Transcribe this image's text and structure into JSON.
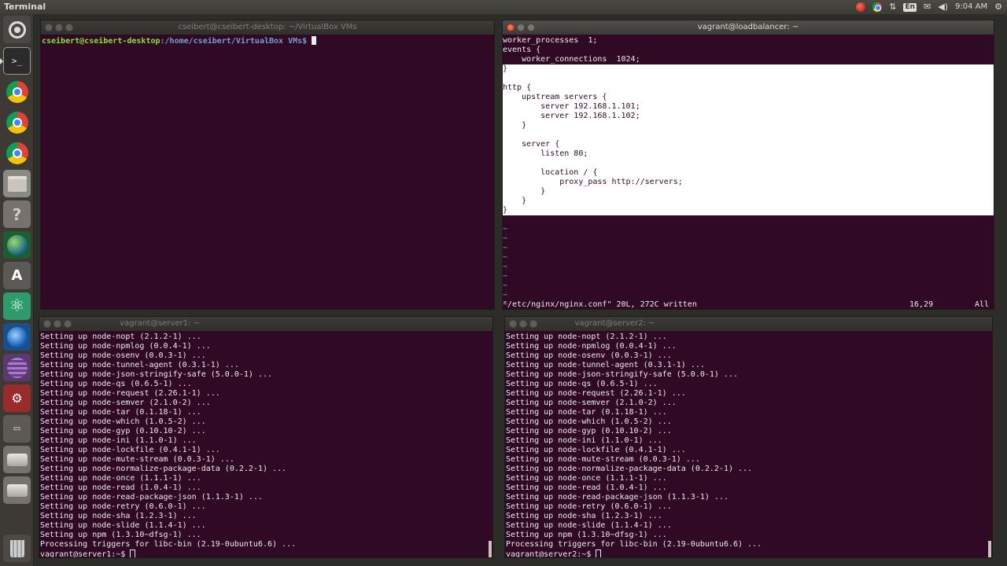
{
  "top_panel": {
    "app_title": "Terminal",
    "language": "En",
    "clock": "9:04 AM",
    "indicators": [
      "network-icon",
      "volume-icon",
      "settings-icon"
    ]
  },
  "launcher": {
    "items": [
      "dash",
      "terminal",
      "chrome",
      "chrome",
      "chrome",
      "files",
      "help",
      "globe",
      "a-app",
      "atom",
      "blue-globe",
      "purple",
      "settings",
      "small-terminal",
      "drive",
      "drive",
      "trash"
    ],
    "terminal_glyph": ">_",
    "help_glyph": "?",
    "a_glyph": "A",
    "atom_glyph": "⚛",
    "settings_glyph": "⚙",
    "small_term_glyph": "▭"
  },
  "window_local": {
    "title": "cseibert@cseibert-desktop: ~/VirtualBox VMs",
    "prompt_user": "cseibert@cseibert-desktop",
    "prompt_path": ":/home/cseibert/VirtualBox VMs$ "
  },
  "window_lb": {
    "title": "vagrant@loadbalancer: ~",
    "lines_top": [
      "worker_processes  1;",
      "events {",
      "    worker_connections  1024;"
    ],
    "lines_selected": [
      "}",
      "",
      "http {",
      "    upstream servers {",
      "        server 192.168.1.101;",
      "        server 192.168.1.102;",
      "    }",
      "",
      "    server {",
      "        listen 80;",
      "",
      "        location / {",
      "            proxy_pass http://servers;",
      "        }",
      "    }",
      "}"
    ],
    "tildes": [
      "~",
      "~",
      "~",
      "~",
      "~",
      "~",
      "~",
      "~",
      "~"
    ],
    "status_file": "\"/etc/nginx/nginx.conf\" 20L, 272C written",
    "status_pos": "16,29",
    "status_all": "All"
  },
  "window_s1": {
    "title": "vagrant@server1: ~",
    "lines": [
      "Setting up node-nopt (2.1.2-1) ...",
      "Setting up node-npmlog (0.0.4-1) ...",
      "Setting up node-osenv (0.0.3-1) ...",
      "Setting up node-tunnel-agent (0.3.1-1) ...",
      "Setting up node-json-stringify-safe (5.0.0-1) ...",
      "Setting up node-qs (0.6.5-1) ...",
      "Setting up node-request (2.26.1-1) ...",
      "Setting up node-semver (2.1.0-2) ...",
      "Setting up node-tar (0.1.18-1) ...",
      "Setting up node-which (1.0.5-2) ...",
      "Setting up node-gyp (0.10.10-2) ...",
      "Setting up node-ini (1.1.0-1) ...",
      "Setting up node-lockfile (0.4.1-1) ...",
      "Setting up node-mute-stream (0.0.3-1) ...",
      "Setting up node-normalize-package-data (0.2.2-1) ...",
      "Setting up node-once (1.1.1-1) ...",
      "Setting up node-read (1.0.4-1) ...",
      "Setting up node-read-package-json (1.1.3-1) ...",
      "Setting up node-retry (0.6.0-1) ...",
      "Setting up node-sha (1.2.3-1) ...",
      "Setting up node-slide (1.1.4-1) ...",
      "Setting up npm (1.3.10~dfsg-1) ...",
      "Processing triggers for libc-bin (2.19-0ubuntu6.6) ..."
    ],
    "prompt": "vagrant@server1:~$ "
  },
  "window_s2": {
    "title": "vagrant@server2: ~",
    "lines": [
      "Setting up node-nopt (2.1.2-1) ...",
      "Setting up node-npmlog (0.0.4-1) ...",
      "Setting up node-osenv (0.0.3-1) ...",
      "Setting up node-tunnel-agent (0.3.1-1) ...",
      "Setting up node-json-stringify-safe (5.0.0-1) ...",
      "Setting up node-qs (0.6.5-1) ...",
      "Setting up node-request (2.26.1-1) ...",
      "Setting up node-semver (2.1.0-2) ...",
      "Setting up node-tar (0.1.18-1) ...",
      "Setting up node-which (1.0.5-2) ...",
      "Setting up node-gyp (0.10.10-2) ...",
      "Setting up node-ini (1.1.0-1) ...",
      "Setting up node-lockfile (0.4.1-1) ...",
      "Setting up node-mute-stream (0.0.3-1) ...",
      "Setting up node-normalize-package-data (0.2.2-1) ...",
      "Setting up node-once (1.1.1-1) ...",
      "Setting up node-read (1.0.4-1) ...",
      "Setting up node-read-package-json (1.1.3-1) ...",
      "Setting up node-retry (0.6.0-1) ...",
      "Setting up node-sha (1.2.3-1) ...",
      "Setting up node-slide (1.1.4-1) ...",
      "Setting up npm (1.3.10~dfsg-1) ...",
      "Processing triggers for libc-bin (2.19-0ubuntu6.6) ..."
    ],
    "prompt": "vagrant@server2:~$ "
  },
  "colors": {
    "terminal_bg": "#300a24",
    "prompt_green": "#8ae234",
    "prompt_blue": "#729fcf",
    "vim_tilde": "#7d9fdb",
    "selection": "#ffffff"
  }
}
